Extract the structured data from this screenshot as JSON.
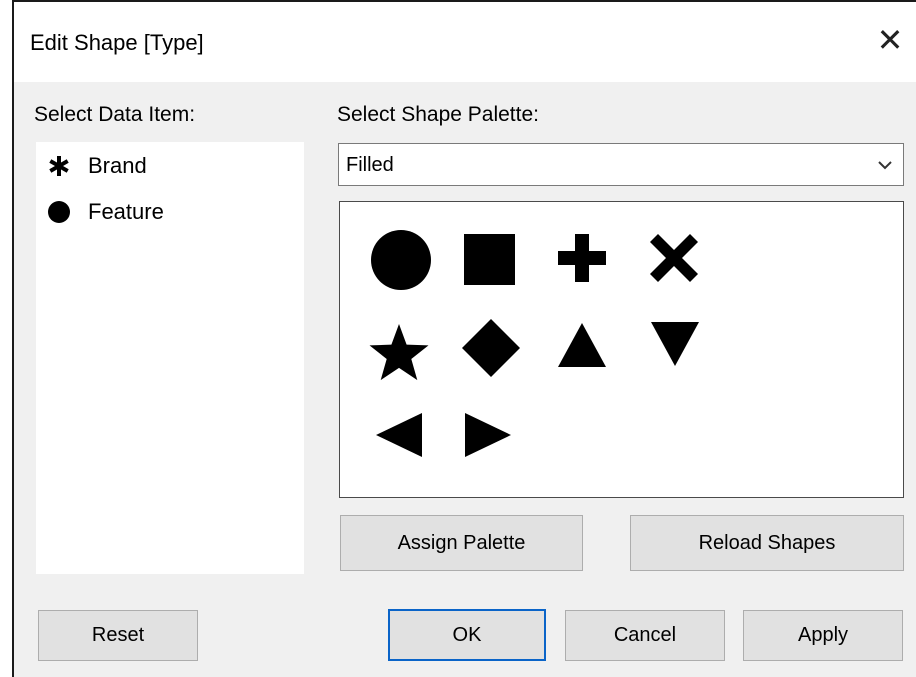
{
  "dialog": {
    "title": "Edit Shape [Type]",
    "close_glyph": "✕"
  },
  "left": {
    "label": "Select Data Item:",
    "items": [
      {
        "label": "Brand",
        "shape": "asterisk"
      },
      {
        "label": "Feature",
        "shape": "filled-circle"
      }
    ]
  },
  "right": {
    "label": "Select Shape Palette:",
    "palette_select": {
      "value": "Filled"
    },
    "shapes": [
      "filled-circle",
      "filled-square",
      "filled-plus",
      "filled-x",
      "filled-star",
      "filled-diamond",
      "filled-triangle-up",
      "filled-triangle-down",
      "filled-triangle-left",
      "filled-triangle-right"
    ],
    "assign_palette_label": "Assign Palette",
    "reload_shapes_label": "Reload Shapes"
  },
  "footer": {
    "reset_label": "Reset",
    "ok_label": "OK",
    "cancel_label": "Cancel",
    "apply_label": "Apply"
  },
  "colors": {
    "dialog_bg": "#f0f0f0",
    "button_bg": "#e1e1e1",
    "default_button_border": "#0a64c8"
  }
}
